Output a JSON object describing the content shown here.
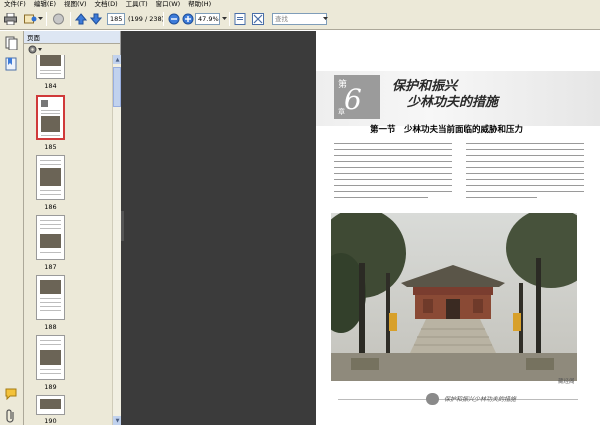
{
  "menubar": {
    "items": [
      "文件(F)",
      "编辑(E)",
      "视图(V)",
      "文档(D)",
      "工具(T)",
      "窗口(W)",
      "帮助(H)"
    ]
  },
  "toolbar": {
    "page_input": "185",
    "page_count": "(199 / 238)",
    "zoom": "47.9%",
    "search_placeholder": "查找"
  },
  "sidebar": {
    "title": "页面",
    "thumbnail_labels": [
      "184",
      "185",
      "186",
      "187",
      "188",
      "189",
      "190"
    ],
    "selected_page": "185"
  },
  "document": {
    "chapter_di": "第",
    "chapter_num": "6",
    "chapter_zhang": "章",
    "chapter_title_line1": "保护和振兴",
    "chapter_title_line2": "少林功夫的措施",
    "section_title": "第一节　少林功夫当前面临的威胁和压力",
    "photo_caption": "藏经阁",
    "footer_text": "保护和振兴少林功夫的措施"
  },
  "colors": {
    "chrome": "#ece9d8",
    "viewer_bg": "#3b3b3b",
    "selection_border": "#d03a3a",
    "chapter_box": "#9b9b9b"
  }
}
